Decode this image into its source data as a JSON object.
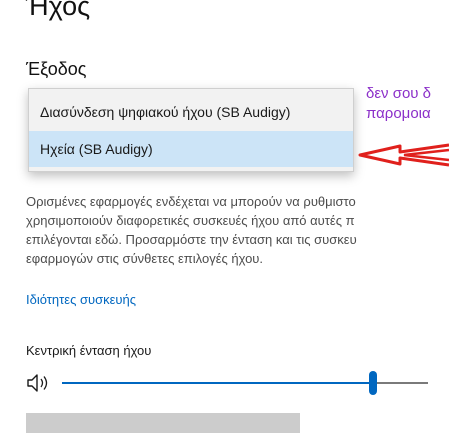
{
  "page": {
    "title": "Ήχος"
  },
  "output": {
    "section_title": "Έξοδος",
    "dropdown": {
      "options": [
        {
          "label": "Διασύνδεση ψηφιακού ήχου (SB Audigy)"
        },
        {
          "label": "Ηχεία (SB Audigy)",
          "selected": true
        }
      ]
    },
    "description_lines": [
      "Ορισμένες εφαρμογές ενδέχεται να μπορούν να ρυθμιστο",
      "χρησιμοποιούν διαφορετικές συσκευές ήχου από αυτές π",
      "επιλέγονται εδώ. Προσαρμόστε την ένταση και τις συσκευ",
      "εφαρμογών στις σύνθετες επιλογές ήχου."
    ],
    "device_properties_link": "Ιδιότητες συσκευής",
    "master_volume": {
      "label": "Κεντρική ένταση ήχου",
      "level_fraction": 0.85
    }
  },
  "annotation": {
    "lines": [
      "δεν σου δ",
      "παρομοια"
    ],
    "color": "#8b2fc9",
    "arrow_color": "#e0201c"
  },
  "colors": {
    "accent": "#0067c0",
    "selected_bg": "#cce4f7"
  },
  "icons": {
    "speaker": "speaker-volume-icon"
  }
}
